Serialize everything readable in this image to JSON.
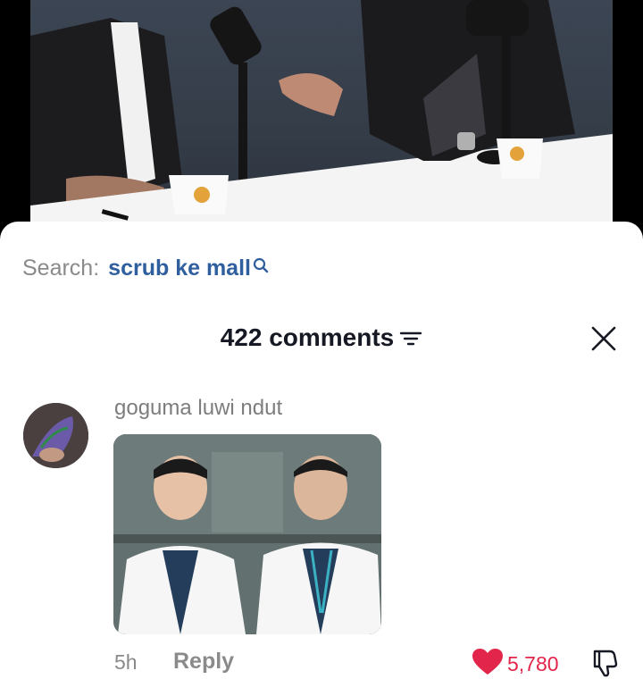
{
  "search": {
    "label": "Search:",
    "term": "scrub ke mall"
  },
  "comments": {
    "count_label": "422 comments"
  },
  "comment": {
    "username": "goguma luwi ndut",
    "time": "5h",
    "reply_label": "Reply",
    "like_count": "5,780"
  },
  "icons": {
    "search": "search-icon",
    "sort": "sort-icon",
    "close": "close-icon",
    "like": "heart-icon",
    "dislike": "thumbs-down-icon"
  },
  "colors": {
    "accent_link": "#2f5f9e",
    "like": "#e2254a",
    "muted": "#8a8a8a"
  }
}
